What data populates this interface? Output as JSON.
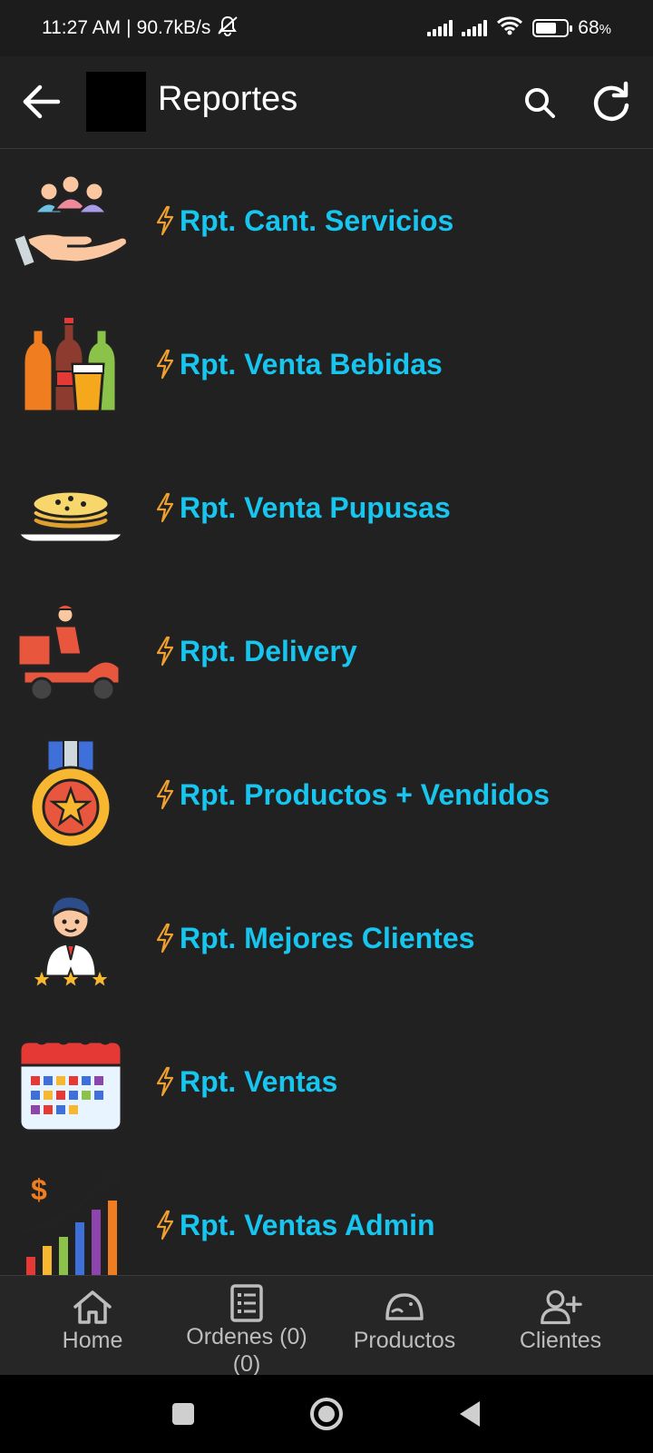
{
  "status_bar": {
    "time": "11:27 AM",
    "separator": "|",
    "speed": "90.7kB/s",
    "battery": "68",
    "battery_unit": "%",
    "battery_level": 0.68
  },
  "app_bar": {
    "title": "Reportes"
  },
  "reports": [
    {
      "label": "Rpt. Cant. Servicios",
      "icon": "people-hand-icon"
    },
    {
      "label": "Rpt. Venta Bebidas",
      "icon": "drinks-icon"
    },
    {
      "label": "Rpt. Venta Pupusas",
      "icon": "pupusas-plate-icon"
    },
    {
      "label": "Rpt. Delivery",
      "icon": "delivery-scooter-icon"
    },
    {
      "label": "Rpt. Productos + Vendidos",
      "icon": "medal-icon"
    },
    {
      "label": "Rpt. Mejores Clientes",
      "icon": "customer-stars-icon"
    },
    {
      "label": "Rpt. Ventas",
      "icon": "calendar-icon"
    },
    {
      "label": "Rpt. Ventas Admin",
      "icon": "sales-growth-chart-icon"
    }
  ],
  "bottom_nav": {
    "home": "Home",
    "ordenes": "Ordenes (0)",
    "ordenes_sub": "(0)",
    "productos": "Productos",
    "clientes": "Clientes"
  },
  "colors": {
    "background": "#212121",
    "label": "#17c5ee",
    "bolt": "#f0a030",
    "nav_text": "#bdbdbd"
  }
}
